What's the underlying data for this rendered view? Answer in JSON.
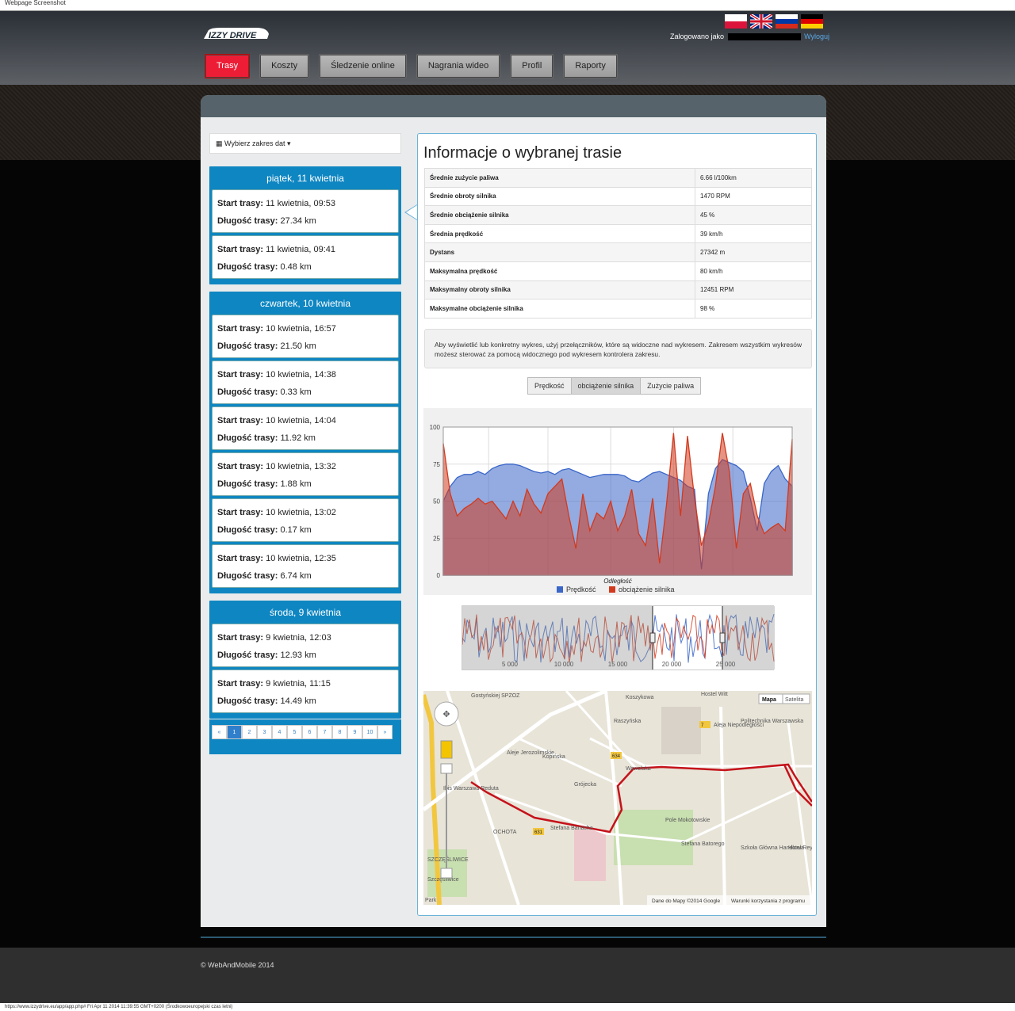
{
  "capture": {
    "label": "Webpage Screenshot",
    "url_line": "https://www.izzydrive.eu/app/app.php# Fri Apr 11 2014 11:39:55 GMT+0200 (Środkowoeuropejski czas letni)"
  },
  "brand": {
    "logo": "IZZY DRIVE"
  },
  "flags": [
    "flag-pl-icon",
    "flag-uk-icon",
    "flag-ru-icon",
    "flag-de-icon"
  ],
  "user": {
    "prefix": "Zalogowano jako",
    "logout": "Wyloguj"
  },
  "nav": {
    "tabs": [
      "Trasy",
      "Koszty",
      "Śledzenie online",
      "Nagrania wideo",
      "Profil",
      "Raporty"
    ],
    "active": 0
  },
  "sidebar": {
    "date_picker": "Wybierz zakres dat",
    "trip_start_label": "Start trasy:",
    "trip_length_label": "Długość trasy:",
    "days": [
      {
        "title": "piątek, 11 kwietnia",
        "trips": [
          {
            "start": "11 kwietnia, 09:53",
            "length": "27.34 km"
          },
          {
            "start": "11 kwietnia, 09:41",
            "length": "0.48 km"
          }
        ]
      },
      {
        "title": "czwartek, 10 kwietnia",
        "trips": [
          {
            "start": "10 kwietnia, 16:57",
            "length": "21.50 km"
          },
          {
            "start": "10 kwietnia, 14:38",
            "length": "0.33 km"
          },
          {
            "start": "10 kwietnia, 14:04",
            "length": "11.92 km"
          },
          {
            "start": "10 kwietnia, 13:32",
            "length": "1.88 km"
          },
          {
            "start": "10 kwietnia, 13:02",
            "length": "0.17 km"
          },
          {
            "start": "10 kwietnia, 12:35",
            "length": "6.74 km"
          }
        ]
      },
      {
        "title": "środa, 9 kwietnia",
        "trips": [
          {
            "start": "9 kwietnia, 12:03",
            "length": "12.93 km"
          },
          {
            "start": "9 kwietnia, 11:15",
            "length": "14.49 km"
          }
        ]
      }
    ],
    "pagination": [
      "«",
      "1",
      "2",
      "3",
      "4",
      "5",
      "6",
      "7",
      "8",
      "9",
      "10",
      "»"
    ],
    "pagination_active": 1
  },
  "info": {
    "title": "Informacje o wybranej trasie",
    "stats": [
      [
        "Średnie zużycie paliwa",
        "6.66 l/100km"
      ],
      [
        "Średnie obroty silnika",
        "1470 RPM"
      ],
      [
        "Średnie obciążenie silnika",
        "45 %"
      ],
      [
        "Średnia prędkość",
        "39 km/h"
      ],
      [
        "Dystans",
        "27342 m"
      ],
      [
        "Maksymalna prędkość",
        "80 km/h"
      ],
      [
        "Maksymalny obroty silnika",
        "12451 RPM"
      ],
      [
        "Maksymalne obciążenie silnika",
        "98 %"
      ]
    ],
    "note": "Aby wyświetlić lub konkretny wykres, użyj przełączników, które są widoczne nad wykresem. Zakresem wszystkim wykresów możesz sterować za pomocą widocznego pod wykresem kontrolera zakresu.",
    "toggles": [
      "Prędkość",
      "obciążenie silnika",
      "Zużycie paliwa"
    ],
    "toggles_active": 1
  },
  "chart_data": {
    "type": "area",
    "xlabel": "Odległość",
    "ylabel": "",
    "ylim": [
      0,
      100
    ],
    "yticks": [
      0,
      25,
      50,
      75,
      100
    ],
    "legend": "bottom",
    "grid": true,
    "x": [
      0,
      2,
      4,
      6,
      8,
      10,
      12,
      14,
      16,
      18,
      20,
      22,
      24,
      26,
      28,
      30,
      32,
      34,
      36,
      38,
      40,
      42,
      44,
      46,
      48,
      50,
      52,
      54,
      56,
      58,
      60,
      62,
      64,
      66,
      68,
      70,
      72,
      74,
      76,
      78,
      80,
      82,
      84,
      86,
      88,
      90,
      92,
      94,
      96,
      98,
      100
    ],
    "series": [
      {
        "name": "Prędkość",
        "color": "#3a66c8",
        "values": [
          50,
          60,
          66,
          68,
          68,
          70,
          68,
          72,
          74,
          75,
          75,
          74,
          72,
          70,
          69,
          70,
          68,
          71,
          72,
          70,
          68,
          66,
          67,
          68,
          68,
          68,
          67,
          64,
          63,
          66,
          69,
          70,
          68,
          66,
          64,
          60,
          58,
          4,
          55,
          72,
          78,
          76,
          74,
          70,
          52,
          30,
          62,
          70,
          74,
          65,
          60
        ]
      },
      {
        "name": "obciążenie silnika",
        "color": "#d23a1e",
        "values": [
          89,
          55,
          40,
          45,
          48,
          52,
          48,
          50,
          44,
          38,
          50,
          40,
          58,
          48,
          42,
          55,
          60,
          65,
          40,
          18,
          55,
          30,
          42,
          38,
          50,
          30,
          40,
          58,
          28,
          20,
          52,
          8,
          48,
          96,
          40,
          94,
          52,
          20,
          35,
          60,
          96,
          70,
          18,
          55,
          62,
          40,
          28,
          32,
          35,
          30,
          92
        ]
      }
    ]
  },
  "navigator": {
    "ticks": [
      "5 000",
      "10 000",
      "15 000",
      "20 000",
      "25 000"
    ]
  },
  "map": {
    "type_buttons": [
      "Mapa",
      "Satelita"
    ],
    "labels": [
      "Gostyńskiej SPZOZ",
      "Koszykowa",
      "Hostel Witt",
      "Politechnika Warszawska",
      "Aleje Jerozolimskie",
      "Raszyńska",
      "Kopińska",
      "Grójecka",
      "Wawelska",
      "Aleja Niepodległości",
      "Ibis Warszawa Reduta",
      "OCHOTA",
      "Stefana Banacha",
      "Pole Mokotowskie",
      "Stefana Batorego",
      "Szkoła Główna Handlowa",
      "Hotel Reytan",
      "SZCZĘŚLIWICE",
      "Szczęśliwice",
      "Park"
    ],
    "road_numbers": [
      "631",
      "634",
      "7"
    ],
    "attribution": "Dane do Mapy ©2014 Google",
    "terms": "Warunki korzystania z programu"
  },
  "footer": {
    "copyright": "© WebAndMobile 2014"
  }
}
